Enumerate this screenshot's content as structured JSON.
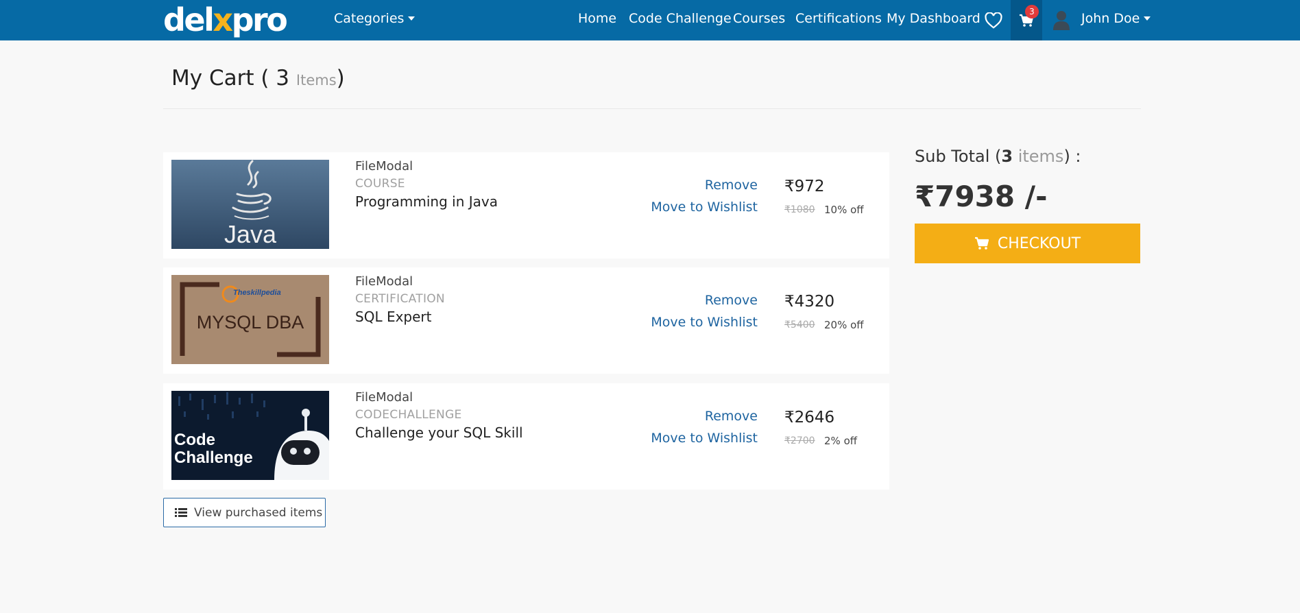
{
  "nav": {
    "logo_pre": "del",
    "logo_x": "x",
    "logo_post": "pro",
    "categories": "Categories",
    "links": [
      "Home",
      "Code Challenge",
      "Courses",
      "Certifications",
      "My Dashboard"
    ],
    "cart_count": "3",
    "user_name": "John Doe"
  },
  "header": {
    "title_prefix": "My Cart (",
    "count": "3",
    "items_word": "Items",
    "title_suffix": ")"
  },
  "cart": {
    "items": [
      {
        "provider": "FileModal",
        "type": "COURSE",
        "name": "Programming in Java",
        "remove": "Remove",
        "wishlist": "Move to Wishlist",
        "price": "₹972",
        "old_price": "₹1080",
        "discount": "10% off",
        "thumb_text": "Java"
      },
      {
        "provider": "FileModal",
        "type": "CERTIFICATION",
        "name": "SQL Expert",
        "remove": "Remove",
        "wishlist": "Move to Wishlist",
        "price": "₹4320",
        "old_price": "₹5400",
        "discount": "20% off",
        "thumb_brand": "Theskillpedia",
        "thumb_text": "MYSQL DBA"
      },
      {
        "provider": "FileModal",
        "type": "CODECHALLENGE",
        "name": "Challenge your SQL Skill",
        "remove": "Remove",
        "wishlist": "Move to Wishlist",
        "price": "₹2646",
        "old_price": "₹2700",
        "discount": "2% off",
        "thumb_line1": "Code",
        "thumb_line2": "Challenge"
      }
    ],
    "view_purchased": "View purchased items"
  },
  "summary": {
    "subtotal_label": "Sub Total (",
    "count": "3",
    "items_word": "items",
    "subtotal_suffix": ") :",
    "total": "₹7938 /-",
    "checkout": "CHECKOUT"
  },
  "colors": {
    "navbar": "#066aa5",
    "checkout": "#f4ae15",
    "link": "#1e64a0",
    "badge": "#e23b3b"
  }
}
